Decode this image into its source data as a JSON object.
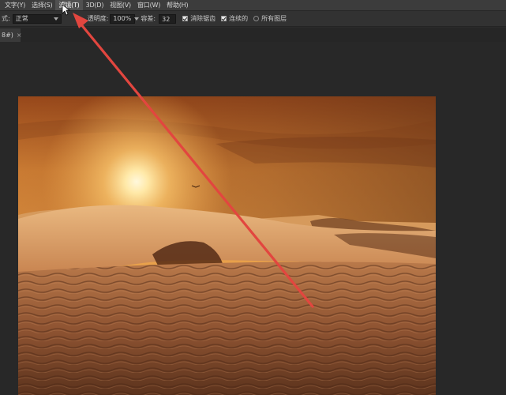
{
  "menubar": {
    "items": [
      {
        "label": "文字(Y)"
      },
      {
        "label": "选择(S)"
      },
      {
        "label": "滤镜(T)"
      },
      {
        "label": "3D(D)"
      },
      {
        "label": "视图(V)"
      },
      {
        "label": "窗口(W)"
      },
      {
        "label": "帮助(H)"
      }
    ]
  },
  "options": {
    "mode_label": "式:",
    "mode_value": "正常",
    "opacity_label": "透明度:",
    "opacity_value": "100%",
    "tolerance_label": "容差:",
    "tolerance_value": "32",
    "antialias_label": "消除锯齿",
    "antialias_checked": true,
    "contiguous_label": "连续的",
    "contiguous_checked": true,
    "all_layers_label": "所有图层",
    "all_layers_checked": false
  },
  "tab": {
    "label": "8#)",
    "close": "×"
  },
  "colors": {
    "arrow": "#e2463f",
    "menubar_bg": "#3c3c3c",
    "workspace_bg": "#282828"
  },
  "canvas": {
    "image_subject": "desert-sunset-dunes"
  }
}
